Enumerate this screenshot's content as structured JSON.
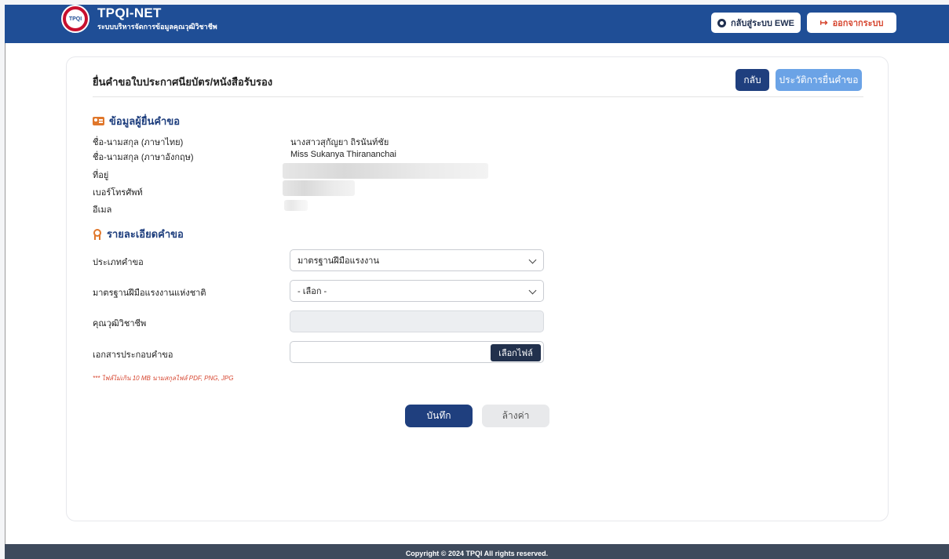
{
  "header": {
    "brand_title": "TPQI-NET",
    "brand_subtitle": "ระบบบริหารจัดการข้อมูลคุณวุฒิวิชาชีพ",
    "logo_text": "TPQI",
    "ewe_button": "กลับสู่ระบบ EWE",
    "logout_button": "ออกจากระบบ"
  },
  "page": {
    "title": "ยื่นคำขอใบประกาศนียบัตร/หนังสือรับรอง",
    "back_button": "กลับ",
    "history_button": "ประวัติการยื่นคำขอ"
  },
  "applicant": {
    "heading": "ข้อมูลผู้ยื่นคำขอ",
    "rows": [
      {
        "label": "ชื่อ-นามสกุล (ภาษาไทย)",
        "value": "นางสาวสุกัญยา ถิรนันท์ชัย"
      },
      {
        "label": "ชื่อ-นามสกุล (ภาษาอังกฤษ)",
        "value": "Miss Sukanya Thirananchai"
      },
      {
        "label": "ที่อยู่",
        "value": ""
      },
      {
        "label": "เบอร์โทรศัพท์",
        "value": ""
      },
      {
        "label": "อีเมล",
        "value": ""
      }
    ]
  },
  "details": {
    "heading": "รายละเอียดคำขอ",
    "request_type_label": "ประเภทคำขอ",
    "request_type_value": "มาตรฐานฝีมือแรงงาน",
    "national_standard_label": "มาตรฐานฝีมือแรงงานแห่งชาติ",
    "national_standard_value": "- เลือก -",
    "qualification_label": "คุณวุฒิวิชาชีพ",
    "qualification_value": "",
    "documents_label": "เอกสารประกอบคำขอ",
    "file_button": "เลือกไฟล์",
    "file_note": "*** ไฟล์ไม่เกิน 10 MB นามสกุลไฟล์ PDF, PNG, JPG"
  },
  "actions": {
    "save": "บันทึก",
    "reset": "ล้างค่า"
  },
  "footer": {
    "copyright": "Copyright © 2024 TPQI All rights reserved."
  },
  "colors": {
    "header_bg": "#1f4e96",
    "primary": "#1f3f7e",
    "secondary": "#6ba3e6",
    "accent_orange": "#e0772b",
    "danger": "#d6452f",
    "footer_bg": "#3e4a5c"
  }
}
